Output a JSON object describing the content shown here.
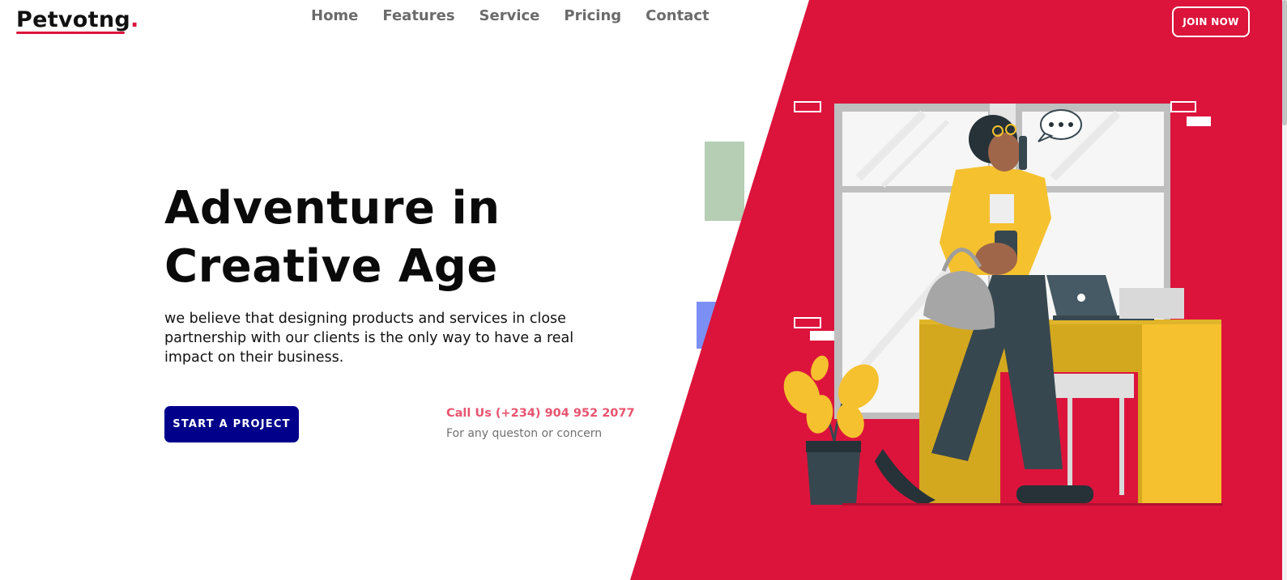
{
  "brand": {
    "name": "Petvotng",
    "dot": "."
  },
  "nav": {
    "items": [
      {
        "label": "Home"
      },
      {
        "label": "Features"
      },
      {
        "label": "Service"
      },
      {
        "label": "Pricing"
      },
      {
        "label": "Contact"
      }
    ]
  },
  "header": {
    "join_label": "JOIN NOW"
  },
  "hero": {
    "title_line1": "Adventure in",
    "title_line2": "Creative Age",
    "description": "we believe that designing products and services in close partnership with our clients is the only way to have a real impact on their business.",
    "cta_label": "START A PROJECT",
    "call_label": "Call Us (+234) 904 952 2077",
    "call_sub": "For any queston or concern"
  },
  "colors": {
    "accent_red": "#dc143c",
    "cta_blue": "#00008b",
    "call_pink": "#e8546f",
    "nav_gray": "#6b6b6b",
    "illustration_yellow": "#f5c12e",
    "illustration_dark": "#37474f"
  },
  "icons": {
    "illustration": "woman-on-phone-office-illustration",
    "speech_bubble": "chat-bubble-icon",
    "plant": "potted-plant-icon",
    "laptop": "laptop-icon"
  }
}
